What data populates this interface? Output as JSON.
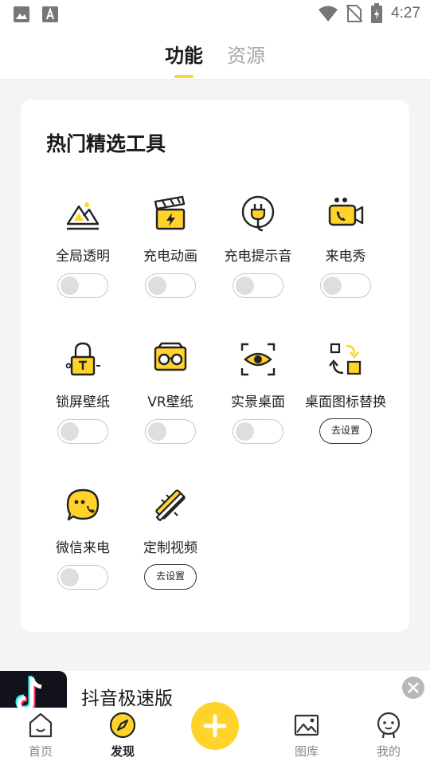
{
  "status_bar": {
    "time": "4:27"
  },
  "header": {
    "tabs": [
      {
        "label": "功能",
        "active": true
      },
      {
        "label": "资源",
        "active": false
      }
    ]
  },
  "card": {
    "title": "热门精选工具",
    "tools": [
      {
        "label": "全局透明",
        "control": "toggle",
        "enabled": false,
        "icon": "landscape-icon"
      },
      {
        "label": "充电动画",
        "control": "toggle",
        "enabled": false,
        "icon": "clapperboard-icon"
      },
      {
        "label": "充电提示音",
        "control": "toggle",
        "enabled": false,
        "icon": "plug-icon"
      },
      {
        "label": "来电秀",
        "control": "toggle",
        "enabled": false,
        "icon": "video-call-icon"
      },
      {
        "label": "锁屏壁纸",
        "control": "toggle",
        "enabled": false,
        "icon": "lock-icon"
      },
      {
        "label": "VR壁纸",
        "control": "toggle",
        "enabled": false,
        "icon": "vr-glasses-icon"
      },
      {
        "label": "实景桌面",
        "control": "toggle",
        "enabled": false,
        "icon": "eye-scan-icon"
      },
      {
        "label": "桌面图标替换",
        "control": "button",
        "button_label": "去设置",
        "icon": "icon-swap-icon"
      },
      {
        "label": "微信来电",
        "control": "toggle",
        "enabled": false,
        "icon": "chat-phone-icon"
      },
      {
        "label": "定制视频",
        "control": "button",
        "button_label": "去设置",
        "icon": "pencil-ruler-icon"
      }
    ]
  },
  "ad_banner": {
    "title": "抖音极速版",
    "logo_icon": "douyin-logo-icon"
  },
  "tab_bar": {
    "items": [
      {
        "label": "首页",
        "active": false,
        "icon": "home-icon"
      },
      {
        "label": "发现",
        "active": true,
        "icon": "compass-icon"
      },
      {
        "label": "图库",
        "active": false,
        "icon": "gallery-icon"
      },
      {
        "label": "我的",
        "active": false,
        "icon": "profile-icon"
      }
    ],
    "fab_icon": "plus-icon"
  },
  "colors": {
    "accent": "#ffd32a",
    "text": "#222222",
    "inactive_text": "#a6a6a6"
  }
}
